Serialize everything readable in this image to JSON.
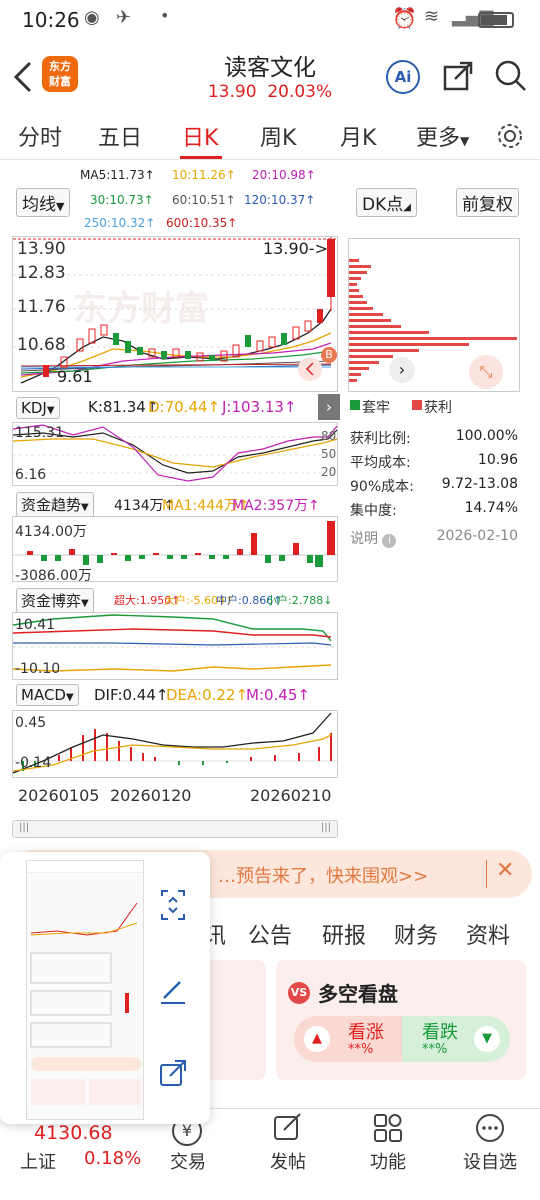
{
  "status": {
    "time": "10:26"
  },
  "header": {
    "title": "读客文化",
    "price": "13.90",
    "change_pct": "20.03%",
    "ai_label": "Ai",
    "logo_line1": "东方",
    "logo_line2": "财富"
  },
  "tabs": [
    "分时",
    "五日",
    "日K",
    "周K",
    "月K",
    "更多"
  ],
  "chart_controls": {
    "ma_select": "均线",
    "dk_button": "DK点",
    "adjust_button": "前复权"
  },
  "ma_labels": [
    {
      "text": "MA5:11.73↑",
      "color": "#222222"
    },
    {
      "text": "10:11.26↑",
      "color": "#e8a400"
    },
    {
      "text": "20:10.98↑",
      "color": "#c21fb5"
    },
    {
      "text": "30:10.73↑",
      "color": "#1a9a3a"
    },
    {
      "text": "60:10.51↑",
      "color": "#555555"
    },
    {
      "text": "120:10.37↑",
      "color": "#2a5db0"
    },
    {
      "text": "250:10.32↑",
      "color": "#4aa3df"
    },
    {
      "text": "600:10.35↑",
      "color": "#c92020"
    }
  ],
  "kline": {
    "y_ticks": [
      "13.90",
      "12.83",
      "11.76",
      "10.68"
    ],
    "last_price_tag": "13.90->",
    "low_label": "9.61",
    "watermark": "东方财富",
    "b_marker": "B"
  },
  "kdj": {
    "selector": "KDJ",
    "k": "K:81.34↑",
    "d": "D:70.44↑",
    "j": "J:103.13↑",
    "y_top": "115.31",
    "y_bottom": "6.16",
    "levels": [
      "80",
      "50",
      "20"
    ]
  },
  "fund_trend": {
    "selector": "资金趋势",
    "value": "4134万↑",
    "ma1": "MA1:444万↑",
    "ma2": "MA2:357万↑",
    "y_top": "4134.00万",
    "y_bottom": "-3086.00万"
  },
  "fund_game": {
    "selector": "资金博弈",
    "super": "超大:1.950↑",
    "big": "大户:-5.604↑",
    "mid": "中户:0.866↑",
    "small": "小户:2.788↓",
    "y_top": "10.41",
    "y_bottom": "-10.10"
  },
  "macd": {
    "selector": "MACD",
    "dif": "DIF:0.44↑",
    "dea": "DEA:0.22↑",
    "m": "M:0.45↑",
    "y_top": "0.45",
    "y_bottom": "-0.14"
  },
  "x_dates": [
    "20260105",
    "20260120",
    "20260210"
  ],
  "chip": {
    "legend_trapped": "套牢",
    "legend_profit": "获利",
    "rows": [
      {
        "label": "获利比例:",
        "value": "100.00%"
      },
      {
        "label": "平均成本:",
        "value": "10.96"
      },
      {
        "label": "90%成本:",
        "value": "9.72-13.08"
      },
      {
        "label": "集中度:",
        "value": "14.74%"
      }
    ],
    "note": "说明",
    "date": "2026-02-10"
  },
  "banner": {
    "text": "…预告来了，快来围观>>"
  },
  "sub_tabs": [
    "讯",
    "公告",
    "研报",
    "财务",
    "资料"
  ],
  "vote": {
    "title": "多空看盘",
    "up_label": "看涨",
    "down_label": "看跌",
    "up_pct": "**%",
    "down_pct": "**%"
  },
  "bottom": {
    "index_value": "4130.68",
    "index_name": "上证",
    "index_change": "0.18%",
    "items": [
      "交易",
      "发帖",
      "功能",
      "设自选"
    ]
  },
  "colors": {
    "up": "#e02020",
    "down": "#1a9a3a",
    "accent": "#e02020"
  }
}
